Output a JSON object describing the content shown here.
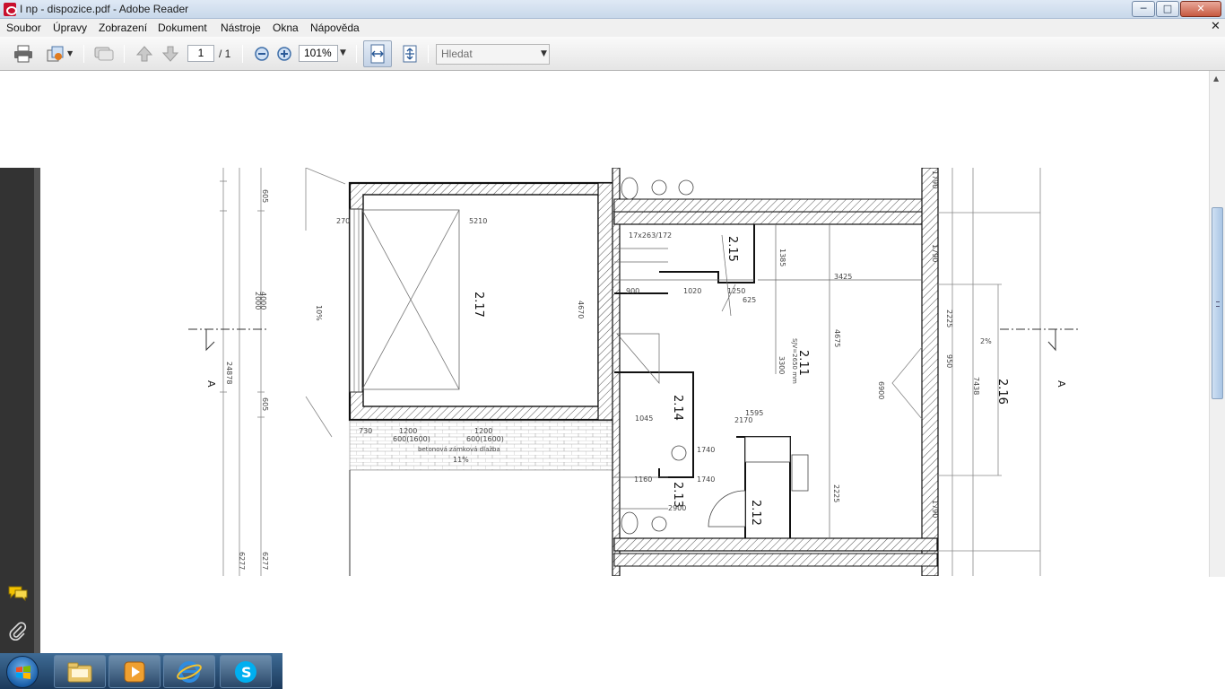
{
  "window": {
    "title": "I np - dispozice.pdf - Adobe Reader",
    "controls": {
      "minimize": "─",
      "maximize": "□",
      "close": "✕"
    }
  },
  "menu": {
    "items": [
      "Soubor",
      "Úpravy",
      "Zobrazení",
      "Dokument",
      "Nástroje",
      "Okna",
      "Nápověda"
    ],
    "close_doc": "✕"
  },
  "toolbar": {
    "page_current": "1",
    "page_total": "/ 1",
    "zoom": "101%",
    "search_placeholder": "Hledat",
    "icons": [
      "print-icon",
      "share-icon",
      "comment-icon",
      "page-up-icon",
      "page-down-icon",
      "zoom-out-icon",
      "zoom-in-icon",
      "fit-width-icon",
      "fit-page-icon"
    ]
  },
  "drawing": {
    "rooms": [
      "2.17",
      "2.15",
      "2.11",
      "2.14",
      "2.13",
      "2.12",
      "2.16"
    ],
    "section_marker": "A",
    "dimensions": {
      "d5210": "5210",
      "d270": "270",
      "d4670": "4670",
      "d3425": "3425",
      "d4675": "4675",
      "d6900": "6900",
      "d3300": "3300",
      "d1595": "1595",
      "d2170": "2170",
      "d1740": "1740",
      "d2900": "2900",
      "d2225": "2225",
      "d1790": "1790",
      "d1385": "1385",
      "d625": "625",
      "d1250": "1250",
      "d1020": "1020",
      "d900": "900",
      "d1045": "1045",
      "d1160": "1160",
      "d730": "730",
      "d1200": "1200",
      "d600": "600(1600)",
      "d2225b": "2225",
      "d950": "950",
      "d4000": "4000",
      "d2000": "2000",
      "d605": "605",
      "d6277": "6277",
      "d24878": "24878",
      "d17": "17x263/172",
      "d2": "2%",
      "d10": "10%",
      "d11": "11%",
      "d7438": "7438"
    },
    "annotations": {
      "pavement": "betonová zámková dlažba",
      "sjv": "SJV=2650 mm"
    }
  },
  "sidebar_icons": [
    "comments-icon",
    "attachment-icon"
  ],
  "taskbar": {
    "apps": [
      "start-orb",
      "explorer-icon",
      "media-player-icon",
      "internet-explorer-icon",
      "skype-icon"
    ]
  }
}
